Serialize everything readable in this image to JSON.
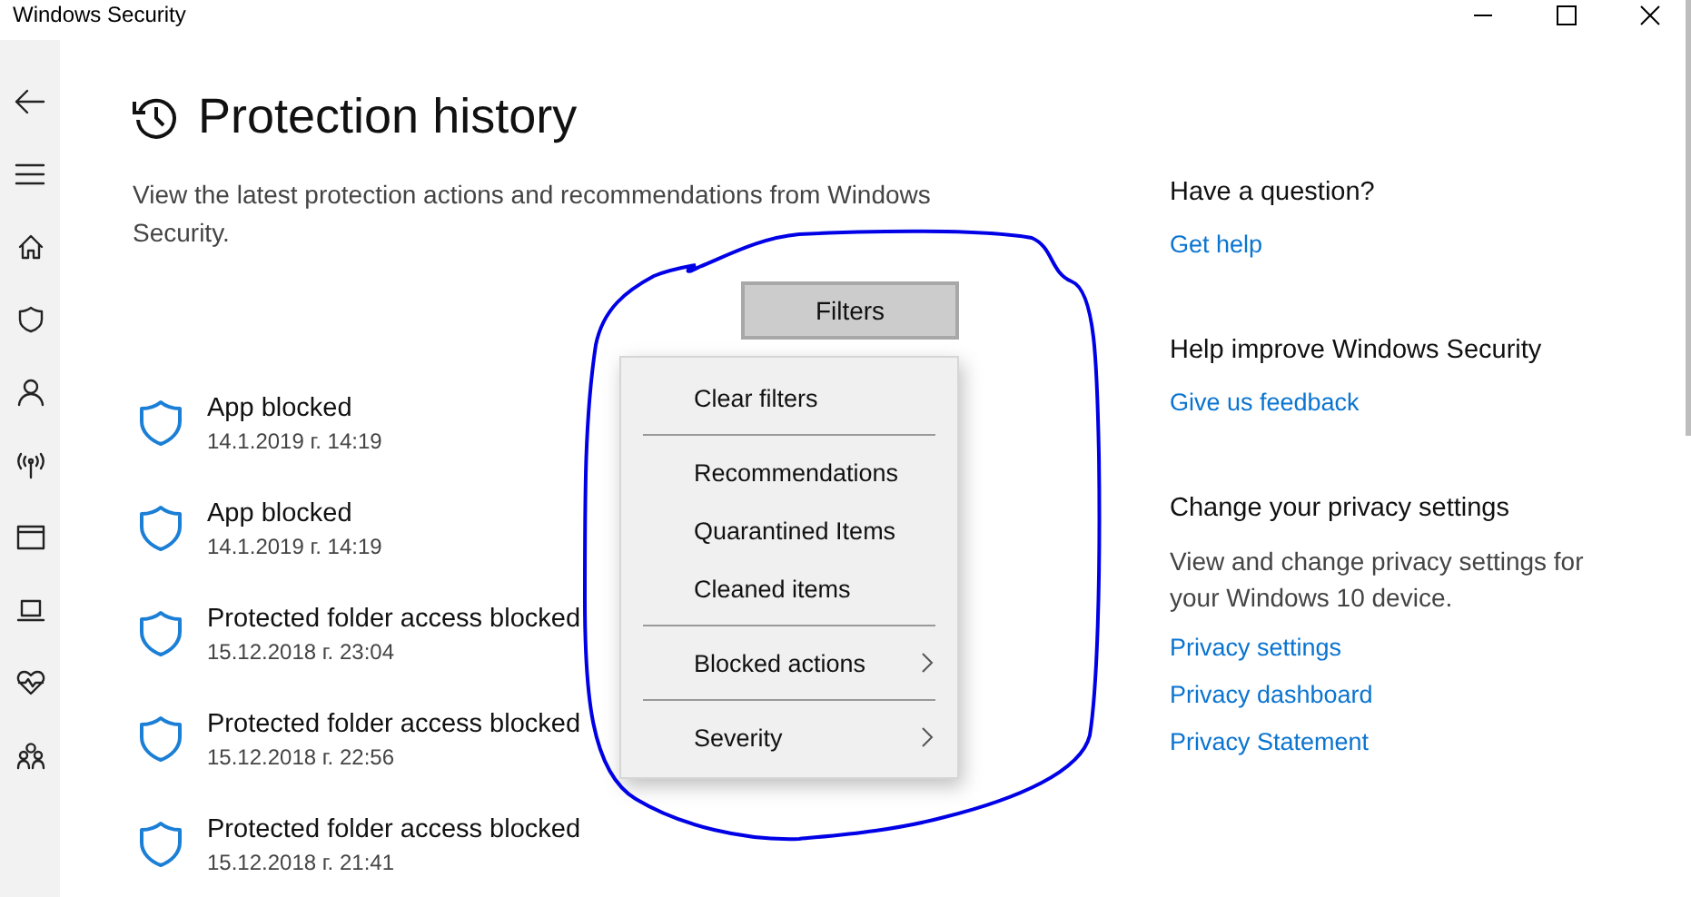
{
  "window": {
    "title": "Windows Security"
  },
  "page": {
    "title": "Protection history",
    "description": "View the latest protection actions and recommendations from Windows Security.",
    "filters_button": "Filters"
  },
  "history": [
    {
      "title": "App blocked",
      "date": "14.1.2019 г. 14:19"
    },
    {
      "title": "App blocked",
      "date": "14.1.2019 г. 14:19"
    },
    {
      "title": "Protected folder access blocked",
      "date": "15.12.2018 г. 23:04"
    },
    {
      "title": "Protected folder access blocked",
      "date": "15.12.2018 г. 22:56"
    },
    {
      "title": "Protected folder access blocked",
      "date": "15.12.2018 г. 21:41"
    }
  ],
  "filter_menu": {
    "items": [
      {
        "label": "Clear filters",
        "submenu": false,
        "separator_after": true
      },
      {
        "label": "Recommendations",
        "submenu": false,
        "separator_after": false
      },
      {
        "label": "Quarantined Items",
        "submenu": false,
        "separator_after": false
      },
      {
        "label": "Cleaned items",
        "submenu": false,
        "separator_after": true
      },
      {
        "label": "Blocked actions",
        "submenu": true,
        "separator_after": true
      },
      {
        "label": "Severity",
        "submenu": true,
        "separator_after": false
      }
    ]
  },
  "side_panel": {
    "sections": [
      {
        "heading": "Have a question?",
        "links": [
          "Get help"
        ]
      },
      {
        "heading": "Help improve Windows Security",
        "links": [
          "Give us feedback"
        ]
      },
      {
        "heading": "Change your privacy settings",
        "text": "View and change privacy settings for your Windows 10 device.",
        "links": [
          "Privacy settings",
          "Privacy dashboard",
          "Privacy Statement"
        ]
      }
    ]
  }
}
